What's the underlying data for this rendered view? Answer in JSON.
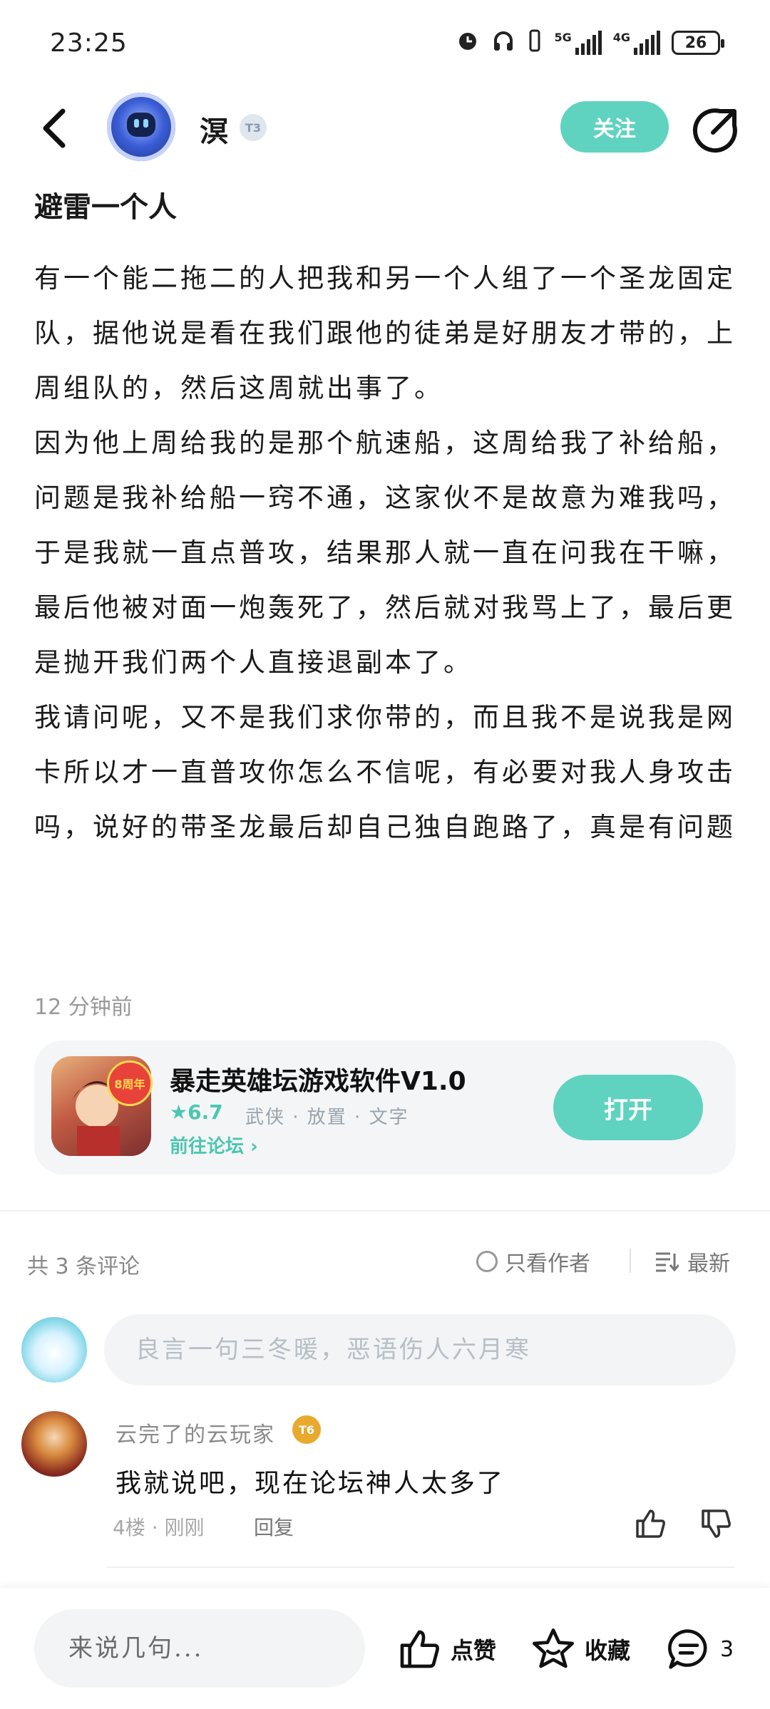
{
  "status_bar": {
    "time": "23:25",
    "battery": "26",
    "net1": "5G",
    "net2": "4G"
  },
  "header": {
    "username": "溟",
    "level": "T3",
    "follow_label": "关注"
  },
  "post": {
    "title": "避雷一个人",
    "paragraphs": [
      "有一个能二拖二的人把我和另一个人组了一个圣龙固定队，据他说是看在我们跟他的徒弟是好朋友才带的，上周组队的，然后这周就出事了。",
      "因为他上周给我的是那个航速船，这周给我了补给船，问题是我补给船一窍不通，这家伙不是故意为难我吗，于是我就一直点普攻，结果那人就一直在问我在干嘛，最后他被对面一炮轰死了，然后就对我骂上了，最后更是抛开我们两个人直接退副本了。",
      "我请问呢，又不是我们求你带的，而且我不是说我是网卡所以才一直普攻你怎么不信呢，有必要对我人身攻击吗，说好的带圣龙最后却自己独自跑路了，真是有问题"
    ],
    "time": "12 分钟前"
  },
  "app_card": {
    "badge": "8周年",
    "name": "暴走英雄坛游戏软件V1.0",
    "rating": "★6.7",
    "tags": "武侠 · 放置 · 文字",
    "forum_link": "前往论坛 ›",
    "open_label": "打开"
  },
  "comments_header": {
    "count": "共 3 条评论",
    "author_only": "只看作者",
    "sort": "最新"
  },
  "comment_input": {
    "placeholder": "良言一句三冬暖，恶语伤人六月寒"
  },
  "comments": [
    {
      "name": "云完了的云玩家",
      "level": "T6",
      "text": "我就说吧，现在论坛神人太多了",
      "meta": "4楼 · 刚刚",
      "reply": "回复"
    }
  ],
  "bottom_bar": {
    "placeholder": "来说几句...",
    "like": "点赞",
    "favorite": "收藏",
    "comment_count": "3"
  }
}
